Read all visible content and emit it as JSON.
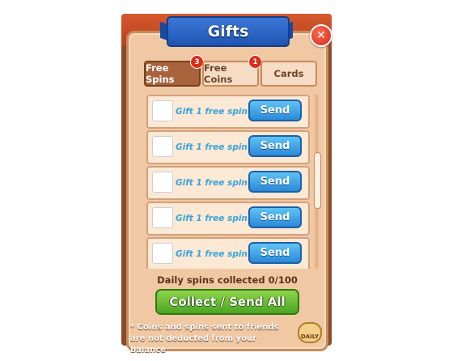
{
  "title": "Gifts",
  "close_icon": "close-icon",
  "tabs": [
    {
      "label": "Free Spins",
      "badge": "3",
      "active": true
    },
    {
      "label": "Free Coins",
      "badge": "1",
      "active": false
    },
    {
      "label": "Cards",
      "badge": "",
      "active": false
    }
  ],
  "gifts": [
    {
      "label": "Gift 1 free spin",
      "button": "Send"
    },
    {
      "label": "Gift 1 free spin",
      "button": "Send"
    },
    {
      "label": "Gift 1 free spin",
      "button": "Send"
    },
    {
      "label": "Gift 1 free spin",
      "button": "Send"
    },
    {
      "label": "Gift 1 free spin",
      "button": "Send"
    }
  ],
  "daily_spins_text": "Daily spins collected 0/100",
  "collect_button": "Collect / Send All",
  "note": "* Coins and spins sent to friends are not deducted from your balance",
  "corner_label": "DAILY",
  "colors": {
    "ribbon": "#1e55b2",
    "send_button": "#2b89d6",
    "collect_button": "#4da524",
    "active_tab": "#a8633d",
    "badge": "#e02a1a"
  }
}
